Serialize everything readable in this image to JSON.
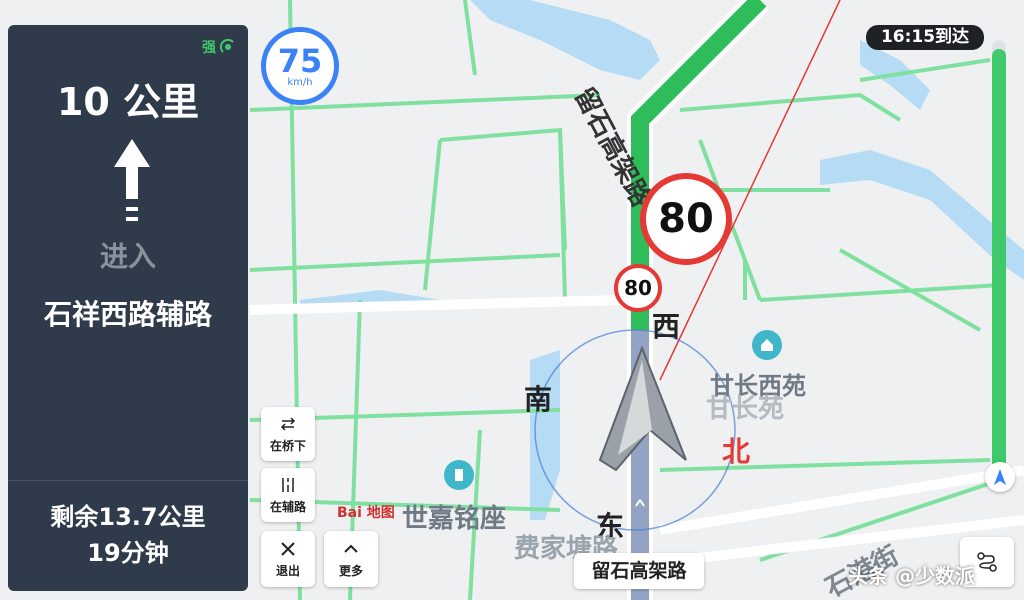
{
  "guidance": {
    "signal_label": "强",
    "distance": "10 公里",
    "action": "进入",
    "road_name": "石祥西路辅路",
    "remaining_distance": "剩余13.7公里",
    "remaining_time": "19分钟"
  },
  "controls": {
    "bridge_under": "在桥下",
    "aux_road": "在辅路",
    "exit": "退出",
    "more": "更多"
  },
  "speed": {
    "current": "75",
    "unit": "km/h"
  },
  "arrival": {
    "text": "16:15到达"
  },
  "route_progress": 0.98,
  "speed_limits": {
    "big": "80",
    "small": "80"
  },
  "compass": {
    "north": "北",
    "south": "南",
    "east": "东",
    "west": "西"
  },
  "map_labels": {
    "highway_name": "留石高架路",
    "poi_1": "甘长西苑",
    "poi_1_faded": "甘长苑",
    "poi_2": "世嘉铭座",
    "road_1": "费家塘路",
    "road_2": "石港街",
    "baidu_logo": "Bai 地图"
  },
  "current_road": "留石高架路",
  "watermark": "头条 @少数派",
  "colors": {
    "panel": "#2f3a4a",
    "route": "#3fc96a",
    "accent": "#3b82f6",
    "limit": "#e53935"
  }
}
